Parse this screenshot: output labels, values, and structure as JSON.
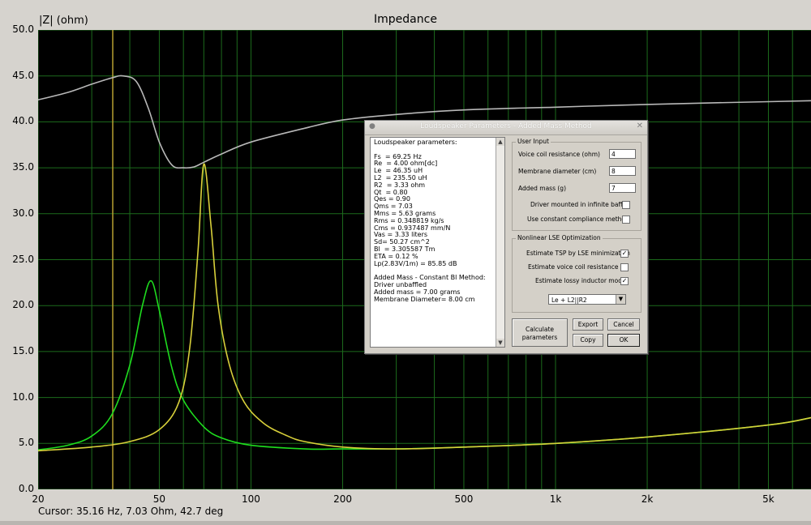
{
  "plot": {
    "title": "Impedance",
    "ylabel": "|Z| (ohm)",
    "cursor_readout": "Cursor: 35.16 Hz, 7.03 Ohm, 42.7 deg",
    "colors": {
      "background": "#000000",
      "grid": "#1c6b1c",
      "phase_curve": "#b8b8b8",
      "impedance_green": "#1edc1e",
      "impedance_yellow": "#d7cf3a",
      "cursor_line": "#b8a030"
    }
  },
  "chart_data": {
    "type": "line",
    "title": "Impedance",
    "ylabel": "|Z| (ohm)",
    "xlabel": "",
    "xscale": "log",
    "xlim": [
      20,
      6900
    ],
    "ylim": [
      0,
      50
    ],
    "y_ticks": [
      "0.0",
      "5.0",
      "10.0",
      "15.0",
      "20.0",
      "25.0",
      "30.0",
      "35.0",
      "40.0",
      "45.0",
      "50.0"
    ],
    "x_tick_labels": [
      {
        "value": 20,
        "label": "20"
      },
      {
        "value": 50,
        "label": "50"
      },
      {
        "value": 100,
        "label": "100"
      },
      {
        "value": 200,
        "label": "200"
      },
      {
        "value": 500,
        "label": "500"
      },
      {
        "value": 1000,
        "label": "1k"
      },
      {
        "value": 2000,
        "label": "2k"
      },
      {
        "value": 5000,
        "label": "5k"
      }
    ],
    "cursor_x": 35.16,
    "series": [
      {
        "color": "#b8b8b8",
        "x": [
          20,
          25,
          30,
          35,
          38,
          42,
          46,
          50,
          55,
          60,
          65,
          70,
          80,
          100,
          150,
          200,
          300,
          500,
          1000,
          2000,
          5000,
          6900
        ],
        "y": [
          42.4,
          43.2,
          44.1,
          44.8,
          45.0,
          44.4,
          41.5,
          37.8,
          35.3,
          35.0,
          35.1,
          35.6,
          36.5,
          37.8,
          39.3,
          40.2,
          40.8,
          41.3,
          41.6,
          41.9,
          42.2,
          42.3
        ]
      },
      {
        "color": "#1edc1e",
        "x": [
          20,
          25,
          30,
          35,
          40,
          44,
          47,
          50,
          55,
          60,
          70,
          80,
          100,
          150,
          200,
          300,
          500,
          1000,
          2000,
          5000,
          6900
        ],
        "y": [
          4.3,
          4.8,
          5.8,
          8.2,
          13.5,
          20.0,
          22.7,
          19.5,
          13.2,
          9.7,
          6.8,
          5.6,
          4.8,
          4.4,
          4.4,
          4.4,
          4.6,
          5.0,
          5.7,
          7.0,
          7.8
        ]
      },
      {
        "color": "#d7cf3a",
        "x": [
          20,
          30,
          40,
          50,
          58,
          63,
          67,
          70,
          74,
          78,
          85,
          95,
          110,
          130,
          150,
          200,
          300,
          500,
          1000,
          2000,
          5000,
          6900
        ],
        "y": [
          4.2,
          4.6,
          5.2,
          6.5,
          9.5,
          15.5,
          26.0,
          35.4,
          28.5,
          20.0,
          13.5,
          9.5,
          7.2,
          5.9,
          5.2,
          4.6,
          4.4,
          4.6,
          5.0,
          5.7,
          7.0,
          7.8
        ]
      }
    ]
  },
  "dialog": {
    "title": "Loudspeaker Parameters - Added Mass Method",
    "results_text": "Loudspeaker parameters:\n\nFs  = 69.25 Hz\nRe  = 4.00 ohm[dc]\nLe  = 46.35 uH\nL2  = 235.50 uH\nR2  = 3.33 ohm\nQt  = 0.80\nQes = 0.90\nQms = 7.03\nMms = 5.63 grams\nRms = 0.348819 kg/s\nCms = 0.937487 mm/N\nVas = 3.33 liters\nSd= 50.27 cm^2\nBl  = 3.305587 Tm\nETA = 0.12 %\nLp(2.83V/1m) = 85.85 dB\n\nAdded Mass - Constant Bl Method:\nDriver unbaffled\nAdded mass = 7.00 grams\nMembrane Diameter= 8.00 cm",
    "user_input": {
      "group_label": "User Input",
      "voice_coil_label": "Voice coil resistance (ohm)",
      "voice_coil_value": "4",
      "membrane_label": "Membrane diameter (cm)",
      "membrane_value": "8",
      "added_mass_label": "Added mass (g)",
      "added_mass_value": "7",
      "infinite_baffle_label": "Driver mounted in infinite baffle",
      "infinite_baffle_checked": "",
      "constant_compliance_label": "Use constant compliance method",
      "constant_compliance_checked": ""
    },
    "lse": {
      "group_label": "Nonlinear LSE Optimization",
      "estimate_tsp_label": "Estimate TSP by LSE minimization",
      "estimate_tsp_checked": "✓",
      "estimate_re_label": "Estimate voice coil resistance Re",
      "estimate_re_checked": "",
      "estimate_lossy_label": "Estimate lossy inductor model",
      "estimate_lossy_checked": "✓",
      "model_select": "Le + L2||R2"
    },
    "buttons": {
      "calculate": "Calculate\nparameters",
      "export": "Export",
      "cancel": "Cancel",
      "copy": "Copy",
      "ok": "OK"
    }
  }
}
